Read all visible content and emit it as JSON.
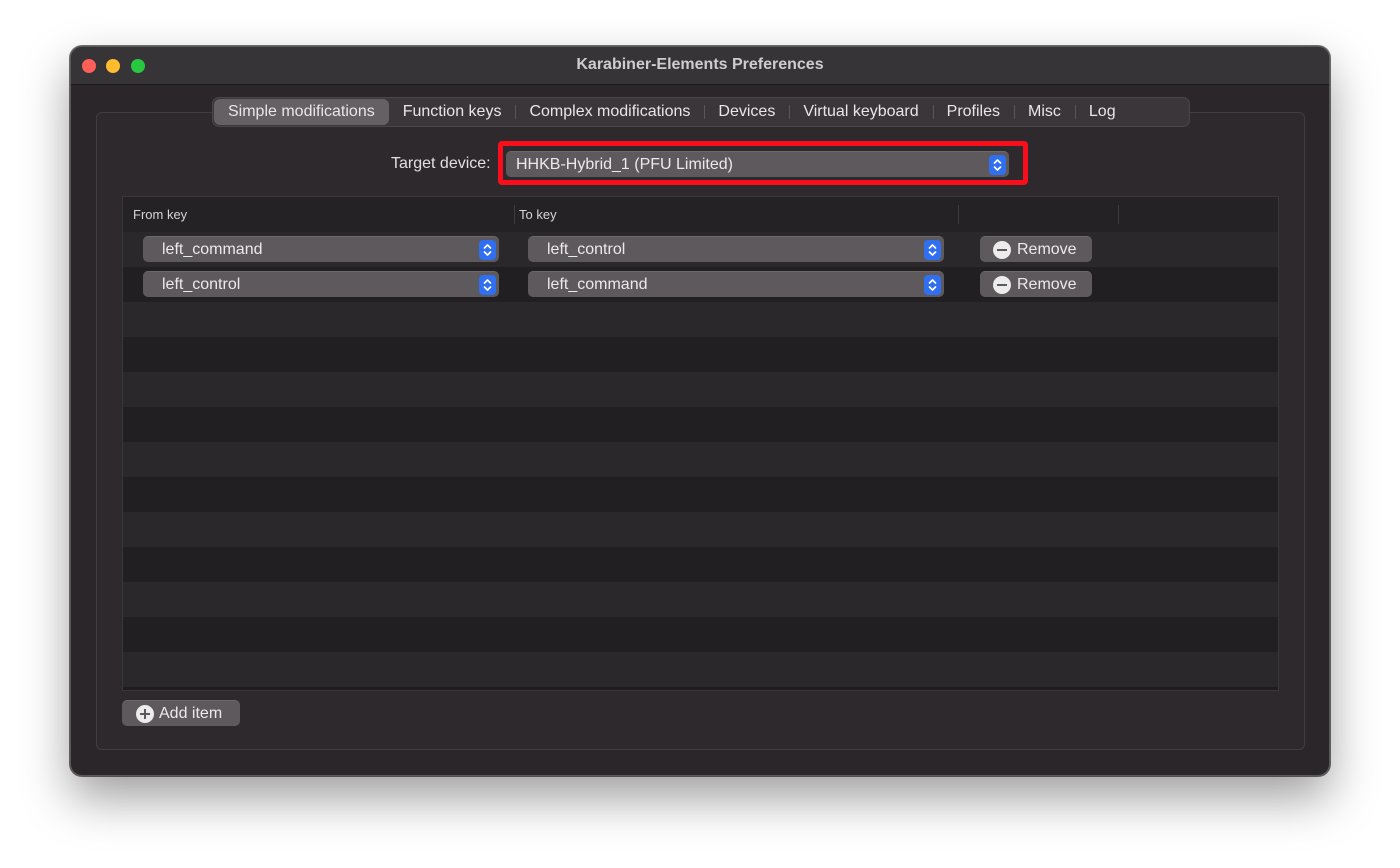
{
  "window": {
    "title": "Karabiner-Elements Preferences"
  },
  "tabs": [
    {
      "label": "Simple modifications",
      "active": true
    },
    {
      "label": "Function keys",
      "active": false
    },
    {
      "label": "Complex modifications",
      "active": false
    },
    {
      "label": "Devices",
      "active": false
    },
    {
      "label": "Virtual keyboard",
      "active": false
    },
    {
      "label": "Profiles",
      "active": false
    },
    {
      "label": "Misc",
      "active": false
    },
    {
      "label": "Log",
      "active": false
    }
  ],
  "target_device": {
    "label": "Target device:",
    "value": "HHKB-Hybrid_1 (PFU Limited)"
  },
  "table": {
    "columns": {
      "from": "From key",
      "to": "To key"
    },
    "rows": [
      {
        "from": "left_command",
        "to": "left_control",
        "remove_label": "Remove"
      },
      {
        "from": "left_control",
        "to": "left_command",
        "remove_label": "Remove"
      }
    ]
  },
  "add_item_label": "Add item",
  "colors": {
    "highlight": "#fc0d1b",
    "accent": "#2f6ff0",
    "window_bg": "#2a2629"
  },
  "icons": {
    "stepper": "up-down-chevron-icon",
    "remove": "minus-circle-icon",
    "add": "plus-circle-icon"
  }
}
